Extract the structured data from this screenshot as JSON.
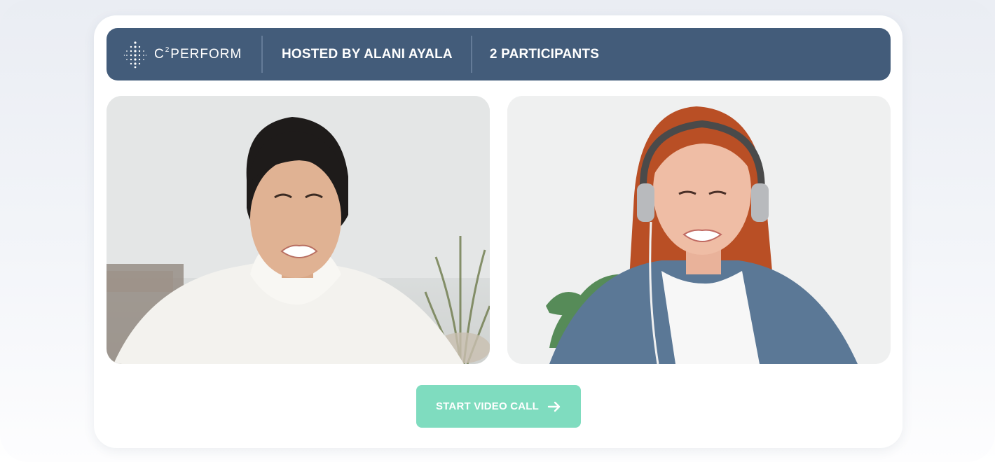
{
  "header": {
    "brand_prefix": "C",
    "brand_super": "2",
    "brand_suffix": "PERFORM",
    "host_text": "HOSTED BY ALANI AYALA",
    "participants_text": "2 PARTICIPANTS"
  },
  "video_tiles": [
    {
      "participant": "participant-1"
    },
    {
      "participant": "participant-2"
    }
  ],
  "actions": {
    "start_call_label": "START VIDEO CALL",
    "start_call_icon": "arrow-right-icon"
  },
  "colors": {
    "header_bg": "#435c7a",
    "cta_bg": "#7fdcbf",
    "card_bg": "#ffffff"
  }
}
